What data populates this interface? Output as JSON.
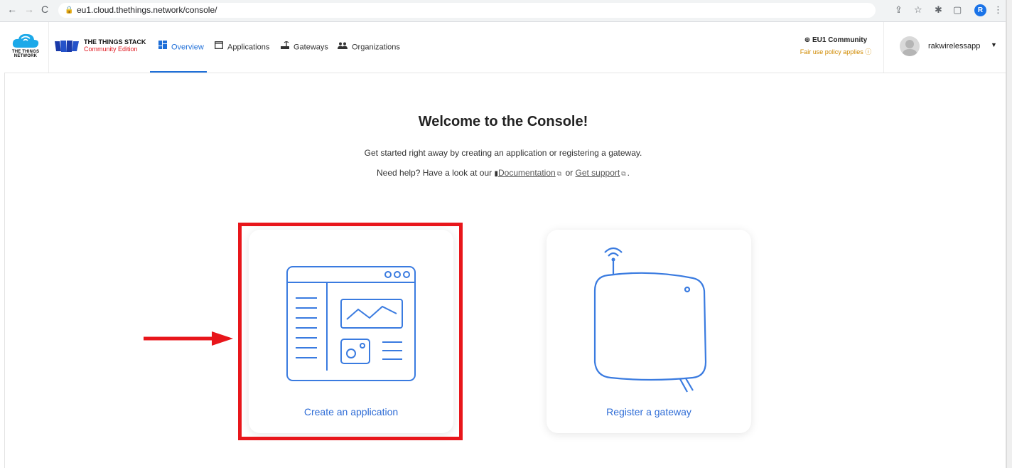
{
  "browser": {
    "url": "eu1.cloud.thethings.network/console/",
    "profile_initial": "R"
  },
  "header": {
    "ttn_logo_text": "THE THINGS NETWORK",
    "stack_title": "THE THINGS STACK",
    "stack_subtitle": "Community Edition",
    "nav": [
      {
        "label": "Overview",
        "icon": "overview-icon",
        "active": true
      },
      {
        "label": "Applications",
        "icon": "applications-icon",
        "active": false
      },
      {
        "label": "Gateways",
        "icon": "gateways-icon",
        "active": false
      },
      {
        "label": "Organizations",
        "icon": "organizations-icon",
        "active": false
      }
    ],
    "community": {
      "name": "EU1 Community",
      "note": "Fair use policy applies"
    },
    "user": {
      "name": "rakwirelessapp"
    }
  },
  "main": {
    "title": "Welcome to the Console!",
    "subtitle": "Get started right away by creating an application or registering a gateway.",
    "help_prefix": "Need help? Have a look at our",
    "doc_link": "Documentation",
    "or_text": "or",
    "support_link": "Get support",
    "period": ".",
    "cards": [
      {
        "label": "Create an application",
        "icon": "application-window-icon"
      },
      {
        "label": "Register a gateway",
        "icon": "gateway-device-icon"
      }
    ]
  },
  "colors": {
    "accent": "#1f6fd8",
    "highlight": "#e8161b",
    "fair_use": "#d08a00",
    "brand_red": "#e0161e"
  }
}
